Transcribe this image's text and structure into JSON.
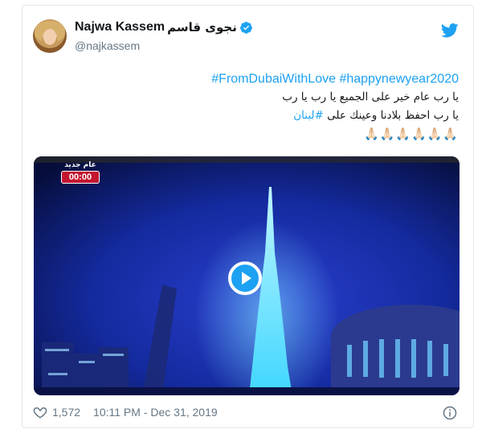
{
  "tweet": {
    "name": "Najwa Kassem",
    "name_arabic": "نجوى قاسم",
    "handle": "@najkassem",
    "hashtags": "#FromDubaiWithLove #happynewyear2020",
    "line1": "يا رب عام خير على الجميع يا رب يا رب",
    "line2_text": "يا رب احفظ بلادنا وعينك على ",
    "line2_link": "#لبنان",
    "emojis": "🙏🏻🙏🏻🙏🏻🙏🏻🙏🏻🙏🏻"
  },
  "video": {
    "overlay_label": "عام جديد",
    "overlay_time": "00:00"
  },
  "footer": {
    "like_count": "1,572",
    "timestamp": "10:11 PM - Dec 31, 2019"
  },
  "colors": {
    "accent": "#1da1f2",
    "text": "#14171a",
    "muted": "#657786",
    "border": "#e1e8ed",
    "video_bg": "#0d1a6b"
  },
  "icons": [
    "twitter-bird-icon",
    "verified-badge-icon",
    "play-icon",
    "heart-icon",
    "info-icon"
  ]
}
